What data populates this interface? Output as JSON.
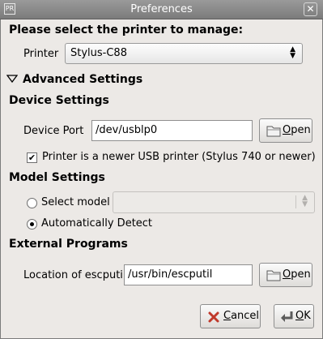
{
  "window": {
    "title": "Preferences",
    "app_icon_text": "PR"
  },
  "printer": {
    "heading": "Please select the printer to manage:",
    "label": "Printer",
    "selected": "Stylus-C88"
  },
  "advanced": {
    "expander_label": "Advanced Settings"
  },
  "device": {
    "heading": "Device Settings",
    "port_label": "Device Port",
    "port_value": "/dev/usblp0",
    "open_label_prefix": "",
    "open_mnemonic": "O",
    "open_label_rest": "pen",
    "newer_usb_label": "Printer is a newer USB printer (Stylus 740 or newer)",
    "newer_usb_checked": true
  },
  "model": {
    "heading": "Model Settings",
    "select_label": "Select model",
    "select_value": "",
    "auto_label": "Automatically Detect",
    "selected_option": "auto"
  },
  "external": {
    "heading": "External Programs",
    "location_label": "Location of escputil",
    "location_value": "/usr/bin/escputil",
    "open_mnemonic": "O",
    "open_label_rest": "pen"
  },
  "footer": {
    "cancel_mnemonic": "C",
    "cancel_rest": "ancel",
    "ok_mnemonic": "O",
    "ok_rest": "K"
  },
  "colors": {
    "titlebar": "#8a8a8a",
    "window_bg": "#ece9e6",
    "cancel_icon": "#c0392b",
    "ok_icon": "#5b5b5b",
    "folder_icon": "#6b6b6b"
  }
}
